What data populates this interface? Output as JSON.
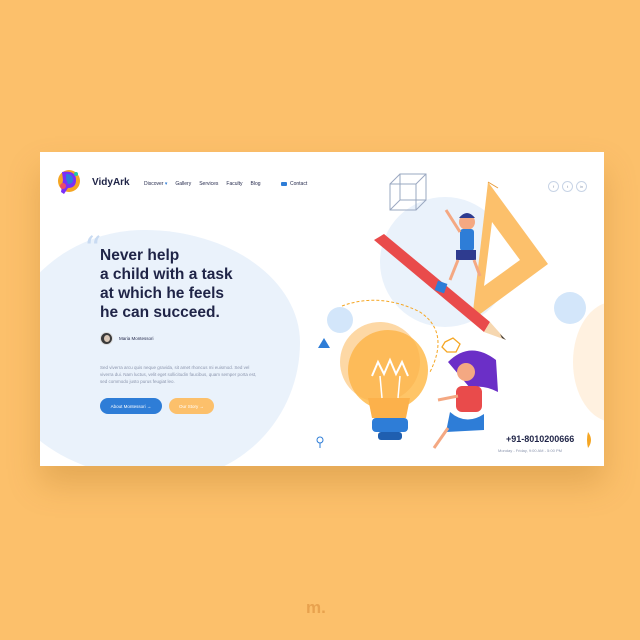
{
  "brand": {
    "name": "VidyArk"
  },
  "nav": {
    "items": [
      "Discover",
      "Gallery",
      "Services",
      "Faculty",
      "Blog"
    ],
    "discover_caret": "▾",
    "contact_label": "Contact"
  },
  "social": [
    "f",
    "t",
    "in"
  ],
  "hero": {
    "quote_mark": "“",
    "headline_lines": [
      "Never help",
      "a child with a task",
      "at which he feels",
      "he can succeed."
    ],
    "author": "Maria Montessori",
    "description": "Sed viverra arcu quis neque gravida, sit amet rhoncus mi euismod. Sed vel viverra dui. Nam luctus, velit eget sollicitudin faucibus, quam semper porta est, sed commodo justo purus feugiat leo.",
    "primary_button": "About Montessori →",
    "secondary_button": "Our Story →"
  },
  "contact_info": {
    "phone": "+91-8010200666",
    "hours": "Monday - Friday, 9:00 AM - 5:00 PM"
  },
  "footer_mark": "m.",
  "colors": {
    "background": "#FCC06B",
    "navy": "#1F2447",
    "primary_blue": "#2E7DD7",
    "light_blue": "#EAF2FB",
    "orange": "#F5A623"
  }
}
